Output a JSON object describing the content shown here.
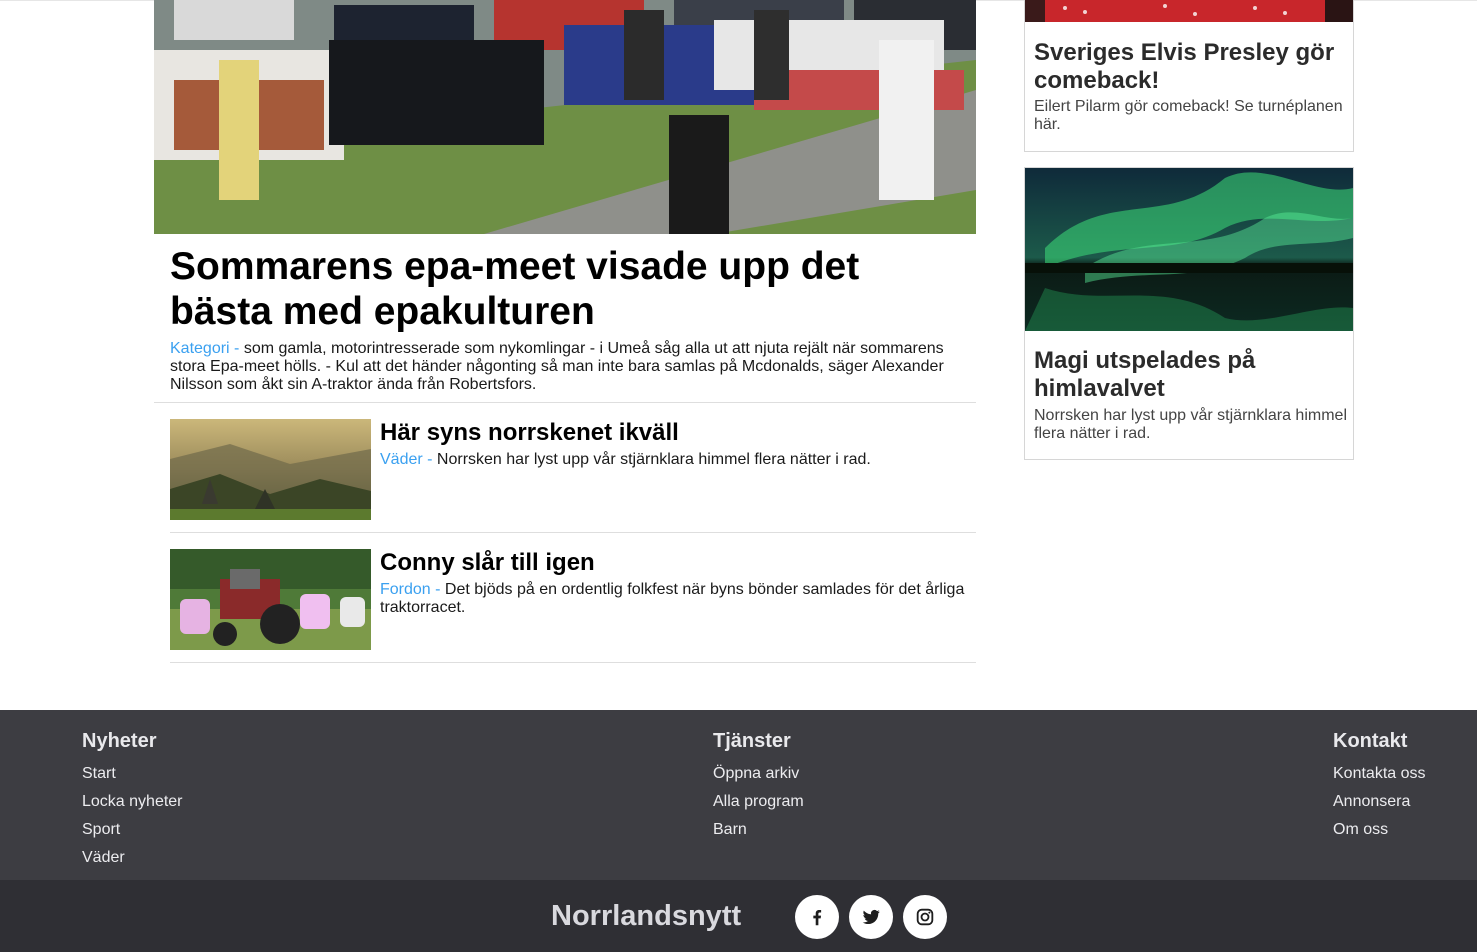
{
  "hero": {
    "title": "Sommarens epa-meet visade upp det bästa med epakulturen",
    "category": "Kategori",
    "separator": " - ",
    "description": "som gamla, motorintresserade som nykomlingar - i Umeå såg alla ut att njuta rejält när sommarens stora Epa-meet hölls. - Kul att det händer någonting så man inte bara samlas på Mcdonalds, säger Alexander Nilsson som åkt sin A-traktor ända från Robertsfors."
  },
  "stories": [
    {
      "title": "Här syns norrskenet ikväll",
      "category": "Väder",
      "separator": " - ",
      "description": "Norrsken har lyst upp vår stjärnklara himmel flera nätter i rad."
    },
    {
      "title": "Conny slår till igen",
      "category": "Fordon",
      "separator": " - ",
      "description": "Det bjöds på en ordentlig folkfest när byns bönder samlades för det årliga traktorracet."
    }
  ],
  "sidebar": [
    {
      "title": "Sveriges Elvis Presley gör comeback!",
      "description": "Eilert Pilarm gör comeback! Se turnéplanen här."
    },
    {
      "title": "Magi utspelades på himlavalvet",
      "description": "Norrsken har lyst upp vår stjärnklara himmel flera nätter i rad."
    }
  ],
  "footer": {
    "columns": [
      {
        "heading": "Nyheter",
        "links": [
          "Start",
          "Locka nyheter",
          "Sport",
          "Väder"
        ]
      },
      {
        "heading": "Tjänster",
        "links": [
          "Öppna arkiv",
          "Alla program",
          "Barn"
        ]
      },
      {
        "heading": "Kontakt",
        "links": [
          "Kontakta oss",
          "Annonsera",
          "Om oss"
        ]
      }
    ],
    "brand": "Norrlandsnytt",
    "social": [
      {
        "icon": "facebook-icon"
      },
      {
        "icon": "twitter-icon"
      },
      {
        "icon": "instagram-icon"
      }
    ]
  },
  "colors": {
    "accent": "#3aa0f0",
    "footer_bg": "#3d3d42",
    "bottombar_bg": "#2f2f34"
  }
}
